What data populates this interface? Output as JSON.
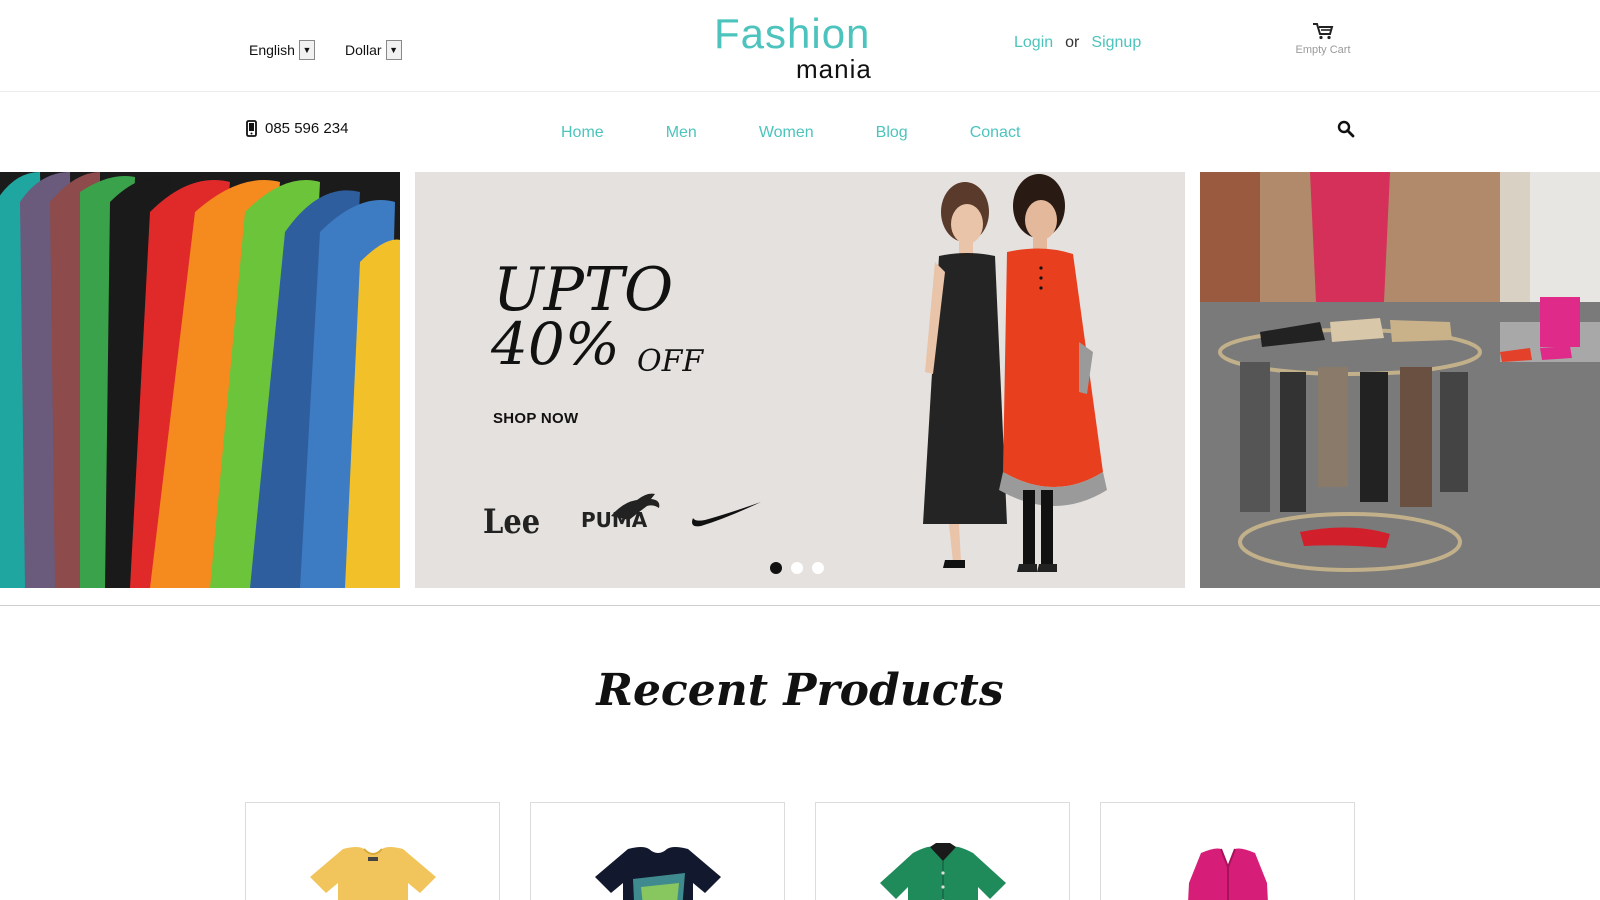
{
  "header": {
    "language": {
      "selected": "English",
      "icon": "dropdown-arrow-icon"
    },
    "currency": {
      "selected": "Dollar",
      "icon": "dropdown-arrow-icon"
    },
    "logo": {
      "line1": "Fashion",
      "line2": "mania"
    },
    "auth": {
      "login": "Login",
      "or": "or",
      "signup": "Signup"
    },
    "cart": {
      "label": "Empty Cart",
      "icon": "cart-icon"
    }
  },
  "navbar": {
    "phone": {
      "number": "085 596 234",
      "icon": "mobile-phone-icon"
    },
    "menu": [
      "Home",
      "Men",
      "Women",
      "Blog",
      "Conact"
    ],
    "search_icon": "search-icon"
  },
  "hero": {
    "promo": {
      "upto": "UPTO",
      "percent": "40%",
      "off": "OFF",
      "cta": "SHOP NOW"
    },
    "brands": {
      "lee": "Lee",
      "puma": "PUMA",
      "nike": "nike-swoosh"
    },
    "slides_count": 3,
    "active_slide": 1
  },
  "recent": {
    "title": "Recent Products",
    "products": [
      "yellow-tshirt",
      "navy-graphic-tshirt",
      "green-shirt",
      "pink-cardigan"
    ]
  },
  "colors": {
    "accent": "#4cc4bd",
    "text": "#111111",
    "banner_bg": "#e5e1de"
  }
}
